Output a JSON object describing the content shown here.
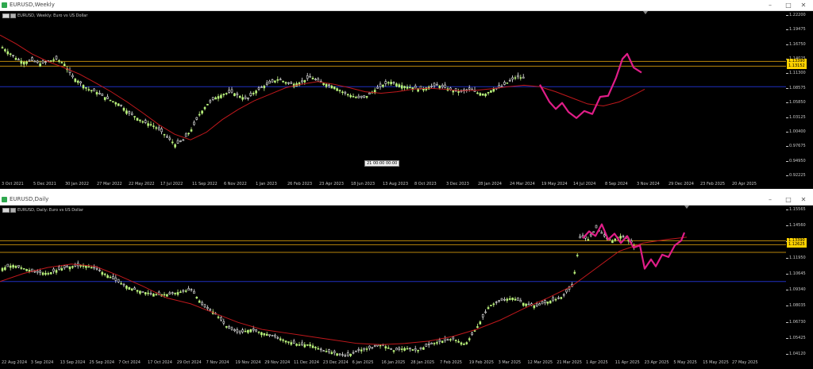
{
  "windows": [
    {
      "id": "weekly",
      "title": "EURUSD,Weekly",
      "symbol_label": "EURUSD, Weekly:  Euro vs US Dollar",
      "y_ticks": [
        "1.22200",
        "1.19475",
        "1.16750",
        "1.14025",
        "1.11300",
        "1.08575",
        "1.05850",
        "1.03125",
        "1.00400",
        "0.97675",
        "0.94950",
        "0.92225"
      ],
      "x_ticks": [
        "3 Oct 2021",
        "5 Dec 2021",
        "30 Jan 2022",
        "27 Mar 2022",
        "22 May 2022",
        "17 Jul 2022",
        "11 Sep 2022",
        "6 Nov 2022",
        "1 Jan 2023",
        "26 Feb 2023",
        "23 Apr 2023",
        "18 Jun 2023",
        "13 Aug 2023",
        "8 Oct 2023",
        "3 Dec 2023",
        "28 Jan 2024",
        "24 Mar 2024",
        "19 May 2024",
        "14 Jul 2024",
        "8 Sep 2024",
        "3 Nov 2024",
        "29 Dec 2024",
        "23 Feb 2025",
        "20 Apr 2025"
      ],
      "price_tags": [
        {
          "text": "1.13390",
          "bg": "#ffd200"
        },
        {
          "text": "1.13152",
          "bg": "#ffd200"
        }
      ],
      "crosshair_label": "21 00:00   00:00",
      "ylim": [
        0.91,
        1.23
      ],
      "hlines": [
        {
          "price": 1.14,
          "color": "#b8860b"
        },
        {
          "price": 1.1305,
          "color": "#b8860b"
        },
        {
          "price": 1.09,
          "color": "#1f2fbf"
        }
      ],
      "ma_points": [
        [
          0,
          1.192
        ],
        [
          20,
          1.175
        ],
        [
          40,
          1.155
        ],
        [
          60,
          1.14
        ],
        [
          80,
          1.128
        ],
        [
          100,
          1.115
        ],
        [
          120,
          1.098
        ],
        [
          140,
          1.08
        ],
        [
          160,
          1.06
        ],
        [
          180,
          1.038
        ],
        [
          200,
          1.015
        ],
        [
          220,
          0.996
        ],
        [
          240,
          0.985
        ],
        [
          260,
          1.0
        ],
        [
          280,
          1.025
        ],
        [
          300,
          1.045
        ],
        [
          320,
          1.062
        ],
        [
          340,
          1.075
        ],
        [
          360,
          1.088
        ],
        [
          380,
          1.095
        ],
        [
          400,
          1.1
        ],
        [
          420,
          1.095
        ],
        [
          440,
          1.088
        ],
        [
          460,
          1.08
        ],
        [
          480,
          1.077
        ],
        [
          500,
          1.08
        ],
        [
          520,
          1.085
        ],
        [
          540,
          1.087
        ],
        [
          560,
          1.085
        ],
        [
          580,
          1.082
        ],
        [
          600,
          1.083
        ],
        [
          620,
          1.086
        ],
        [
          640,
          1.09
        ],
        [
          660,
          1.093
        ],
        [
          680,
          1.09
        ],
        [
          700,
          1.08
        ],
        [
          720,
          1.068
        ],
        [
          740,
          1.056
        ],
        [
          760,
          1.052
        ],
        [
          780,
          1.06
        ],
        [
          800,
          1.075
        ],
        [
          812,
          1.085
        ]
      ],
      "candle_path": [
        [
          0,
          1.17
        ],
        [
          10,
          1.158
        ],
        [
          20,
          1.145
        ],
        [
          30,
          1.138
        ],
        [
          40,
          1.142
        ],
        [
          50,
          1.135
        ],
        [
          60,
          1.14
        ],
        [
          70,
          1.145
        ],
        [
          80,
          1.135
        ],
        [
          90,
          1.11
        ],
        [
          100,
          1.098
        ],
        [
          110,
          1.085
        ],
        [
          120,
          1.08
        ],
        [
          130,
          1.07
        ],
        [
          140,
          1.062
        ],
        [
          150,
          1.055
        ],
        [
          160,
          1.04
        ],
        [
          170,
          1.03
        ],
        [
          180,
          1.02
        ],
        [
          190,
          1.015
        ],
        [
          200,
          1.005
        ],
        [
          210,
          0.99
        ],
        [
          220,
          0.975
        ],
        [
          230,
          0.985
        ],
        [
          240,
          1.005
        ],
        [
          250,
          1.035
        ],
        [
          260,
          1.055
        ],
        [
          270,
          1.068
        ],
        [
          280,
          1.075
        ],
        [
          290,
          1.08
        ],
        [
          300,
          1.072
        ],
        [
          310,
          1.065
        ],
        [
          320,
          1.08
        ],
        [
          330,
          1.09
        ],
        [
          340,
          1.098
        ],
        [
          350,
          1.105
        ],
        [
          360,
          1.098
        ],
        [
          370,
          1.095
        ],
        [
          380,
          1.1
        ],
        [
          390,
          1.11
        ],
        [
          400,
          1.1
        ],
        [
          410,
          1.095
        ],
        [
          420,
          1.09
        ],
        [
          430,
          1.08
        ],
        [
          440,
          1.073
        ],
        [
          450,
          1.068
        ],
        [
          460,
          1.07
        ],
        [
          470,
          1.082
        ],
        [
          480,
          1.092
        ],
        [
          490,
          1.1
        ],
        [
          500,
          1.095
        ],
        [
          510,
          1.09
        ],
        [
          520,
          1.088
        ],
        [
          530,
          1.085
        ],
        [
          540,
          1.09
        ],
        [
          550,
          1.093
        ],
        [
          560,
          1.088
        ],
        [
          570,
          1.082
        ],
        [
          580,
          1.08
        ],
        [
          590,
          1.085
        ],
        [
          600,
          1.078
        ],
        [
          610,
          1.075
        ],
        [
          620,
          1.085
        ],
        [
          630,
          1.09
        ],
        [
          640,
          1.1
        ],
        [
          650,
          1.11
        ],
        [
          660,
          1.106
        ]
      ],
      "zigzag": [
        [
          680,
          1.094
        ],
        [
          692,
          1.06
        ],
        [
          700,
          1.046
        ],
        [
          708,
          1.058
        ],
        [
          716,
          1.04
        ],
        [
          726,
          1.028
        ],
        [
          736,
          1.042
        ],
        [
          746,
          1.036
        ],
        [
          756,
          1.07
        ],
        [
          766,
          1.072
        ],
        [
          776,
          1.108
        ],
        [
          784,
          1.145
        ],
        [
          790,
          1.155
        ],
        [
          798,
          1.128
        ],
        [
          808,
          1.118
        ]
      ]
    },
    {
      "id": "daily",
      "title": "EURUSD,Daily",
      "symbol_label": "EURUSD, Daily:  Euro vs US Dollar",
      "y_ticks": [
        "1.15565",
        "1.14560",
        "1.13295",
        "1.11950",
        "1.10645",
        "1.09340",
        "1.08035",
        "1.06730",
        "1.05425",
        "1.04120"
      ],
      "x_ticks": [
        "22 Aug 2024",
        "3 Sep 2024",
        "13 Sep 2024",
        "25 Sep 2024",
        "7 Oct 2024",
        "17 Oct 2024",
        "29 Oct 2024",
        "7 Nov 2024",
        "19 Nov 2024",
        "29 Nov 2024",
        "11 Dec 2024",
        "23 Dec 2024",
        "6 Jan 2025",
        "16 Jan 2025",
        "28 Jan 2025",
        "7 Feb 2025",
        "19 Feb 2025",
        "3 Mar 2025",
        "12 Mar 2025",
        "21 Mar 2025",
        "1 Apr 2025",
        "11 Apr 2025",
        "23 Apr 2025",
        "5 May 2025",
        "15 May 2025",
        "27 May 2025"
      ],
      "price_tags": [
        {
          "text": "1.13390",
          "bg": "#ffd200"
        },
        {
          "text": "1.12625",
          "bg": "#ffd200"
        }
      ],
      "ylim": [
        1.035,
        1.16
      ],
      "hlines": [
        {
          "price": 1.1339,
          "color": "#b8860b"
        },
        {
          "price": 1.1305,
          "color": "#b8860b"
        },
        {
          "price": 1.124,
          "color": "#b8860b"
        },
        {
          "price": 1.099,
          "color": "#1f2fbf"
        }
      ],
      "ma_points": [
        [
          0,
          1.099
        ],
        [
          30,
          1.106
        ],
        [
          60,
          1.111
        ],
        [
          90,
          1.114
        ],
        [
          120,
          1.112
        ],
        [
          150,
          1.104
        ],
        [
          180,
          1.095
        ],
        [
          210,
          1.085
        ],
        [
          240,
          1.08
        ],
        [
          270,
          1.072
        ],
        [
          300,
          1.064
        ],
        [
          330,
          1.058
        ],
        [
          360,
          1.055
        ],
        [
          390,
          1.052
        ],
        [
          420,
          1.049
        ],
        [
          450,
          1.046
        ],
        [
          480,
          1.045
        ],
        [
          510,
          1.046
        ],
        [
          540,
          1.048
        ],
        [
          570,
          1.052
        ],
        [
          600,
          1.058
        ],
        [
          630,
          1.066
        ],
        [
          660,
          1.076
        ],
        [
          690,
          1.085
        ],
        [
          720,
          1.095
        ],
        [
          750,
          1.11
        ],
        [
          780,
          1.125
        ],
        [
          810,
          1.132
        ],
        [
          840,
          1.135
        ],
        [
          865,
          1.137
        ]
      ],
      "candle_path": [
        [
          0,
          1.11
        ],
        [
          15,
          1.113
        ],
        [
          30,
          1.11
        ],
        [
          45,
          1.107
        ],
        [
          60,
          1.106
        ],
        [
          75,
          1.11
        ],
        [
          90,
          1.112
        ],
        [
          105,
          1.113
        ],
        [
          120,
          1.11
        ],
        [
          135,
          1.104
        ],
        [
          150,
          1.098
        ],
        [
          165,
          1.093
        ],
        [
          180,
          1.09
        ],
        [
          195,
          1.088
        ],
        [
          210,
          1.088
        ],
        [
          225,
          1.09
        ],
        [
          240,
          1.092
        ],
        [
          255,
          1.078
        ],
        [
          270,
          1.072
        ],
        [
          285,
          1.06
        ],
        [
          300,
          1.055
        ],
        [
          315,
          1.058
        ],
        [
          330,
          1.055
        ],
        [
          345,
          1.052
        ],
        [
          360,
          1.048
        ],
        [
          375,
          1.045
        ],
        [
          390,
          1.045
        ],
        [
          405,
          1.04
        ],
        [
          420,
          1.038
        ],
        [
          435,
          1.035
        ],
        [
          450,
          1.04
        ],
        [
          465,
          1.042
        ],
        [
          480,
          1.045
        ],
        [
          495,
          1.04
        ],
        [
          510,
          1.042
        ],
        [
          525,
          1.04
        ],
        [
          540,
          1.045
        ],
        [
          555,
          1.048
        ],
        [
          570,
          1.05
        ],
        [
          585,
          1.045
        ],
        [
          600,
          1.06
        ],
        [
          615,
          1.078
        ],
        [
          630,
          1.083
        ],
        [
          645,
          1.085
        ],
        [
          660,
          1.08
        ],
        [
          675,
          1.078
        ],
        [
          690,
          1.082
        ],
        [
          705,
          1.085
        ],
        [
          720,
          1.095
        ],
        [
          730,
          1.138
        ],
        [
          740,
          1.135
        ],
        [
          750,
          1.145
        ],
        [
          760,
          1.138
        ],
        [
          770,
          1.134
        ],
        [
          780,
          1.138
        ],
        [
          790,
          1.136
        ],
        [
          800,
          1.128
        ]
      ],
      "zigzag": [
        [
          734,
          1.136
        ],
        [
          742,
          1.142
        ],
        [
          750,
          1.138
        ],
        [
          758,
          1.148
        ],
        [
          766,
          1.135
        ],
        [
          774,
          1.14
        ],
        [
          782,
          1.132
        ],
        [
          790,
          1.138
        ],
        [
          798,
          1.128
        ],
        [
          806,
          1.13
        ],
        [
          812,
          1.11
        ],
        [
          820,
          1.118
        ],
        [
          826,
          1.112
        ],
        [
          834,
          1.122
        ],
        [
          842,
          1.12
        ],
        [
          850,
          1.13
        ],
        [
          858,
          1.134
        ],
        [
          862,
          1.141
        ]
      ]
    }
  ]
}
